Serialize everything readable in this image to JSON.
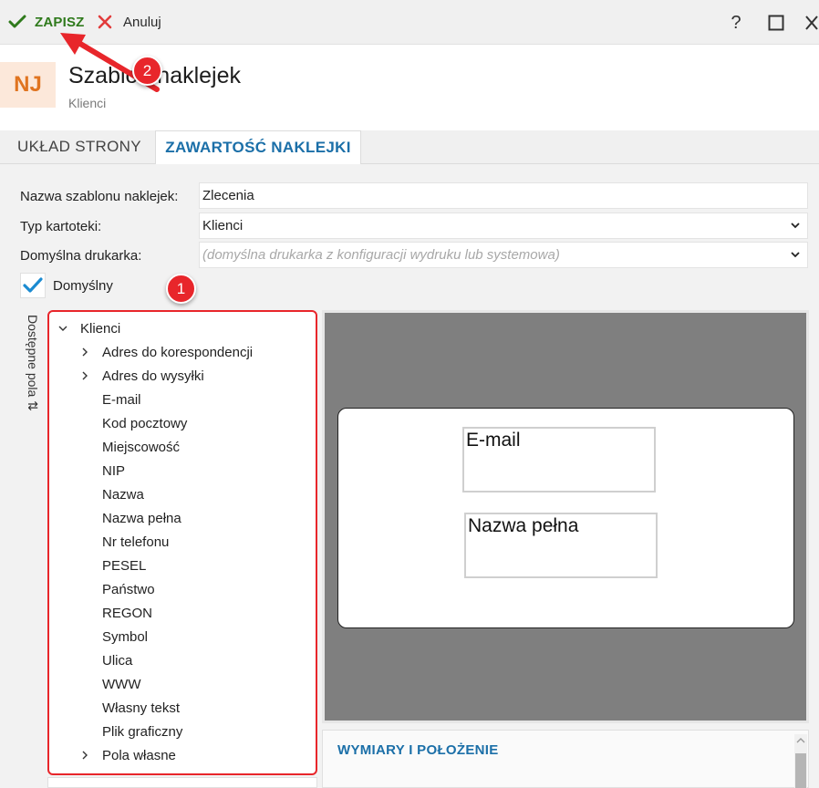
{
  "toolbar": {
    "save_label": "ZAPISZ",
    "cancel_label": "Anuluj",
    "help_label": "?"
  },
  "header": {
    "avatar_initials": "NJ",
    "title": "Szablon naklejek",
    "subtitle": "Klienci"
  },
  "tabs": [
    {
      "label": "UKŁAD STRONY"
    },
    {
      "label": "ZAWARTOŚĆ NAKLEJKI"
    }
  ],
  "form": {
    "name_label": "Nazwa szablonu naklejek:",
    "name_value": "Zlecenia",
    "type_label": "Typ kartoteki:",
    "type_value": "Klienci",
    "printer_label": "Domyślna drukarka:",
    "printer_placeholder": "(domyślna drukarka z konfiguracji wydruku lub systemowa)",
    "default_label": "Domyślny"
  },
  "side_label": "Dostępne pola ⇅",
  "tree": {
    "root": "Klienci",
    "items": [
      {
        "label": "Adres do korespondencji",
        "expandable": true
      },
      {
        "label": "Adres do wysyłki",
        "expandable": true
      },
      {
        "label": "E-mail"
      },
      {
        "label": "Kod pocztowy"
      },
      {
        "label": "Miejscowość"
      },
      {
        "label": "NIP"
      },
      {
        "label": "Nazwa"
      },
      {
        "label": "Nazwa pełna"
      },
      {
        "label": "Nr telefonu"
      },
      {
        "label": "PESEL"
      },
      {
        "label": "Państwo"
      },
      {
        "label": "REGON"
      },
      {
        "label": "Symbol"
      },
      {
        "label": "Ulica"
      },
      {
        "label": "WWW"
      },
      {
        "label": "Własny tekst"
      },
      {
        "label": "Plik graficzny"
      },
      {
        "label": "Pola własne",
        "expandable": true
      }
    ]
  },
  "preview": {
    "field1": "E-mail",
    "field2": "Nazwa pełna"
  },
  "panel": {
    "title": "WYMIARY I POŁOŻENIE"
  },
  "badges": {
    "one": "1",
    "two": "2"
  },
  "colors": {
    "accent": "#1b6fa8",
    "save_green": "#2f7a1c",
    "highlight_red": "#e8262b",
    "avatar_orange": "#e07420"
  }
}
